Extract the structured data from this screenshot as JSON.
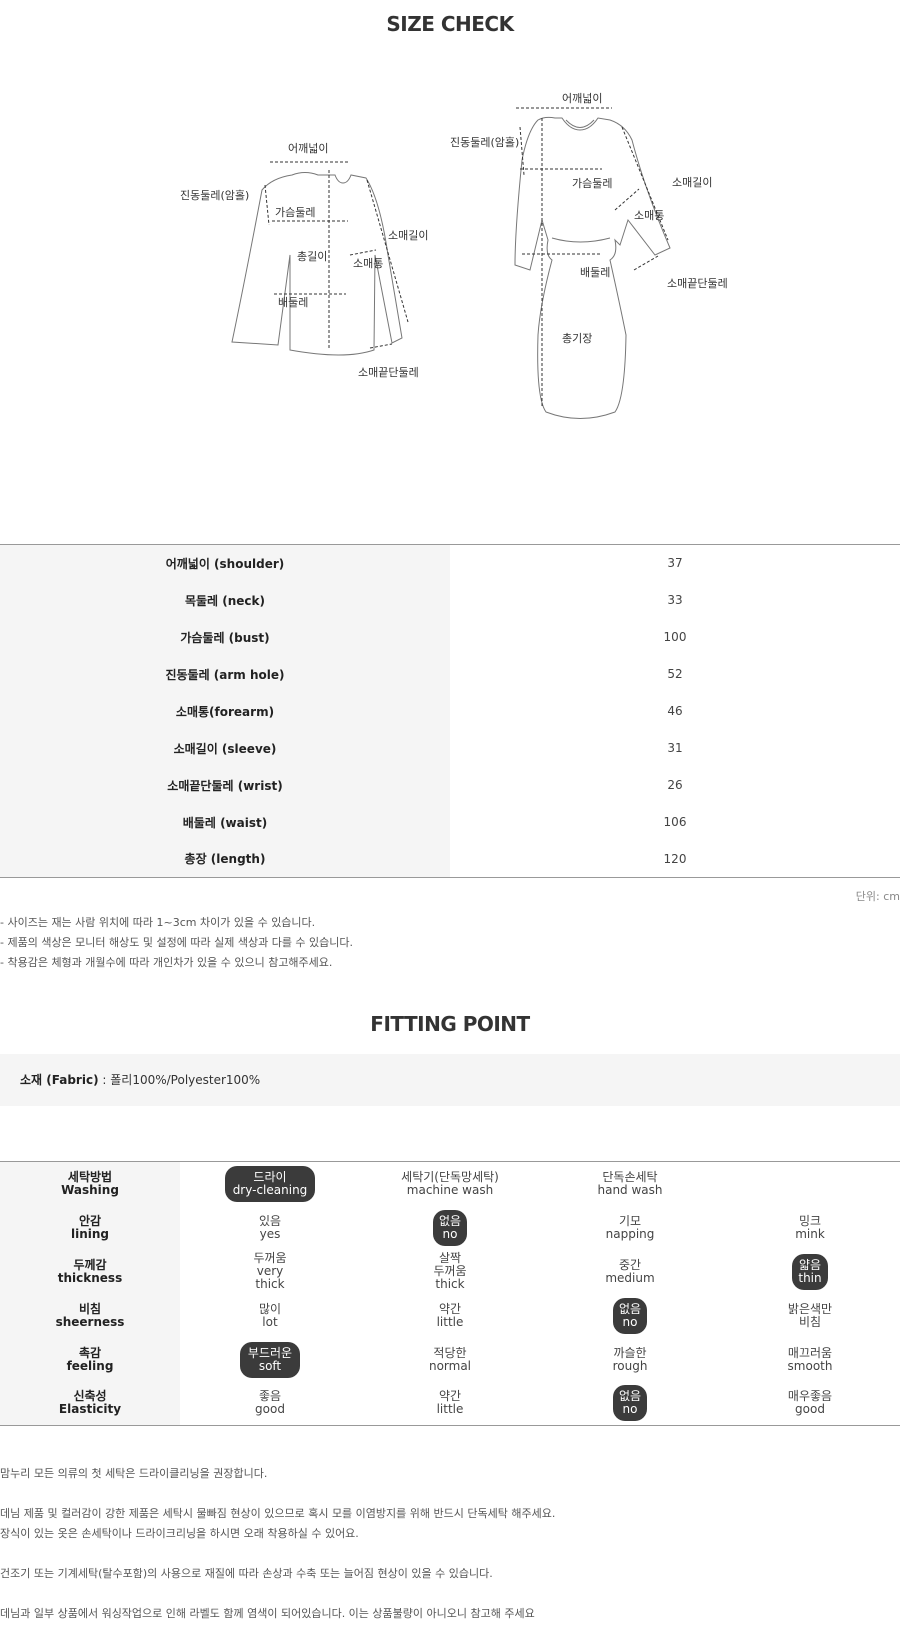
{
  "size_check": {
    "title": "SIZE CHECK",
    "top_labels": {
      "shoulder": "어깨넓이",
      "armhole": "진동둘레(암홀)",
      "bust": "가슴둘레",
      "sleeve": "소매길이",
      "forearm": "소매통",
      "total": "총길이",
      "waist": "배둘레",
      "wrist": "소매끝단둘레"
    },
    "dress_labels": {
      "shoulder": "어깨넓이",
      "armhole": "진동둘레(암홀)",
      "bust": "가슴둘레",
      "sleeve": "소매길이",
      "forearm": "소매통",
      "waist": "배둘레",
      "wrist": "소매끝단둘레",
      "length": "총기장"
    },
    "rows": [
      {
        "label": "어깨넓이 (shoulder)",
        "value": "37"
      },
      {
        "label": "목둘레 (neck)",
        "value": "33"
      },
      {
        "label": "가슴둘레 (bust)",
        "value": "100"
      },
      {
        "label": "진동둘레 (arm hole)",
        "value": "52"
      },
      {
        "label": "소매통(forearm)",
        "value": "46"
      },
      {
        "label": "소매길이 (sleeve)",
        "value": "31"
      },
      {
        "label": "소매끝단둘레 (wrist)",
        "value": "26"
      },
      {
        "label": "배둘레 (waist)",
        "value": "106"
      },
      {
        "label": "총장 (length)",
        "value": "120"
      }
    ],
    "unit": "단위: cm",
    "notes": [
      "- 사이즈는 재는 사람 위치에 따라 1~3cm 차이가 있을 수 있습니다.",
      "- 제품의 색상은 모니터 해상도 및 설정에 따라 실제 색상과 다를 수 있습니다.",
      "- 착용감은 체형과 개월수에 따라 개인차가 있을 수 있으니 참고해주세요."
    ]
  },
  "fitting_point": {
    "title": "FITTING POINT",
    "fabric_label": "소재 (Fabric)",
    "fabric_value": " : 폴리100%/Polyester100%",
    "rows": [
      {
        "ko": "세탁방법",
        "en": "Washing",
        "options": [
          {
            "ko": "드라이",
            "en": "dry-cleaning",
            "selected": true
          },
          {
            "ko": "세탁기(단독망세탁)",
            "en": "machine wash",
            "selected": false
          },
          {
            "ko": "단독손세탁",
            "en": "hand wash",
            "selected": false
          },
          {
            "ko": "",
            "en": "",
            "selected": false
          }
        ]
      },
      {
        "ko": "안감",
        "en": "lining",
        "options": [
          {
            "ko": "있음",
            "en": "yes",
            "selected": false
          },
          {
            "ko": "없음",
            "en": "no",
            "selected": true
          },
          {
            "ko": "기모",
            "en": "napping",
            "selected": false
          },
          {
            "ko": "밍크",
            "en": "mink",
            "selected": false
          }
        ]
      },
      {
        "ko": "두께감",
        "en": "thickness",
        "options": [
          {
            "ko": "두꺼움",
            "en": "very thick",
            "selected": false
          },
          {
            "ko": "살짝 두꺼움",
            "en": "thick",
            "selected": false
          },
          {
            "ko": "중간",
            "en": "medium",
            "selected": false
          },
          {
            "ko": "얇음",
            "en": "thin",
            "selected": true
          }
        ]
      },
      {
        "ko": "비침",
        "en": "sheerness",
        "options": [
          {
            "ko": "많이",
            "en": "lot",
            "selected": false
          },
          {
            "ko": "약간",
            "en": "little",
            "selected": false
          },
          {
            "ko": "없음",
            "en": "no",
            "selected": true
          },
          {
            "ko": "밝은색만 비침",
            "en": "",
            "selected": false
          }
        ]
      },
      {
        "ko": "촉감",
        "en": "feeling",
        "options": [
          {
            "ko": "부드러운",
            "en": "soft",
            "selected": true
          },
          {
            "ko": "적당한",
            "en": "normal",
            "selected": false
          },
          {
            "ko": "까슬한",
            "en": "rough",
            "selected": false
          },
          {
            "ko": "매끄러움",
            "en": "smooth",
            "selected": false
          }
        ]
      },
      {
        "ko": "신축성",
        "en": "Elasticity",
        "options": [
          {
            "ko": "좋음",
            "en": "good",
            "selected": false
          },
          {
            "ko": "약간",
            "en": "little",
            "selected": false
          },
          {
            "ko": "없음",
            "en": "no",
            "selected": true
          },
          {
            "ko": "매우좋음",
            "en": "good",
            "selected": false
          }
        ]
      }
    ],
    "care_notes": [
      "맘누리 모든 의류의 첫 세탁은 드라이클리닝을 권장합니다.",
      "",
      "데님 제품 및 컬러감이 강한 제품은 세탁시 물빠짐 현상이 있으므로 혹시 모를 이염방지를 위해 반드시 단독세탁 해주세요.",
      "장식이 있는 옷은 손세탁이나 드라이크리닝을 하시면 오래 착용하실 수 있어요.",
      "",
      "건조기 또는 기계세탁(탈수포함)의 사용으로 재질에 따라 손상과 수축 또는 늘어짐 현상이 있을 수 있습니다.",
      "",
      "데님과 일부 상품에서 워싱작업으로 인해 라벨도 함께 염색이 되어있습니다. 이는 상품불량이 아니오니 참고해 주세요"
    ]
  }
}
